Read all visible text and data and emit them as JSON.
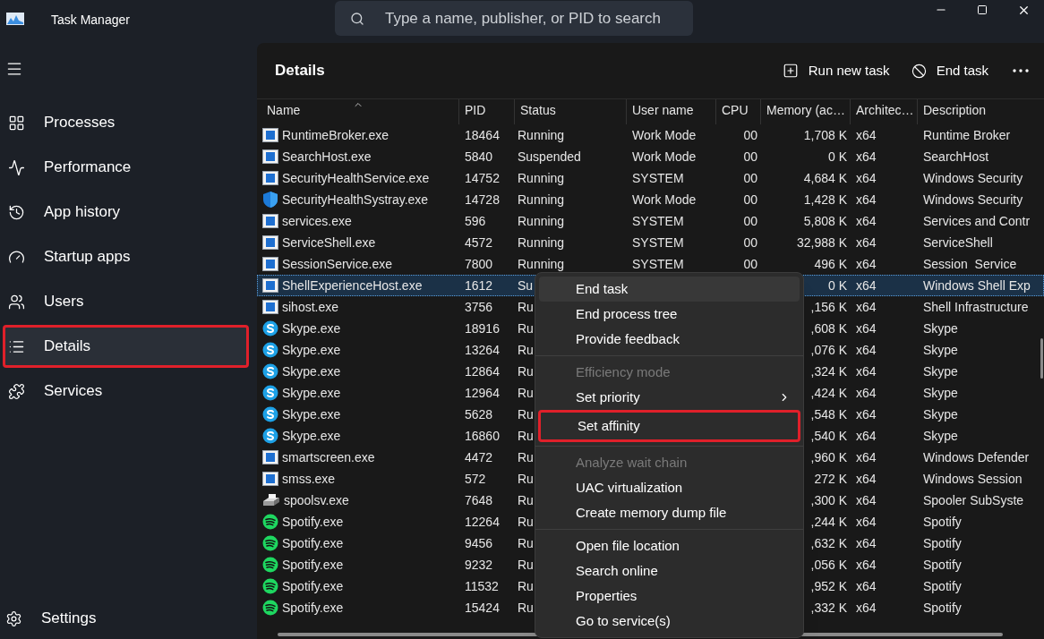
{
  "window": {
    "title": "Task Manager"
  },
  "search": {
    "placeholder": "Type a name, publisher, or PID to search"
  },
  "sidebar": {
    "items": [
      {
        "label": "Processes",
        "selected": false,
        "annotated": false
      },
      {
        "label": "Performance",
        "selected": false,
        "annotated": false
      },
      {
        "label": "App history",
        "selected": false,
        "annotated": false
      },
      {
        "label": "Startup apps",
        "selected": false,
        "annotated": false
      },
      {
        "label": "Users",
        "selected": false,
        "annotated": false
      },
      {
        "label": "Details",
        "selected": true,
        "annotated": true
      },
      {
        "label": "Services",
        "selected": false,
        "annotated": false
      }
    ],
    "footer": {
      "label": "Settings"
    }
  },
  "page": {
    "title": "Details",
    "actions": [
      {
        "label": "Run new task"
      },
      {
        "label": "End task"
      }
    ]
  },
  "table": {
    "columns": [
      {
        "label": "Name",
        "sorted": true
      },
      {
        "label": "PID",
        "sorted": false
      },
      {
        "label": "Status",
        "sorted": false
      },
      {
        "label": "User name",
        "sorted": false
      },
      {
        "label": "CPU",
        "sorted": false
      },
      {
        "label": "Memory (ac…",
        "sorted": false
      },
      {
        "label": "Architec…",
        "sorted": false
      },
      {
        "label": "Description",
        "sorted": false
      }
    ],
    "rows": [
      {
        "kind": "app",
        "selected": false,
        "cells": [
          "RuntimeBroker.exe",
          "18464",
          "Running",
          "Work Mode",
          "00",
          "1,708 K",
          "x64",
          "Runtime Broker"
        ]
      },
      {
        "kind": "app",
        "selected": false,
        "cells": [
          "SearchHost.exe",
          "5840",
          "Suspended",
          "Work Mode",
          "00",
          "0 K",
          "x64",
          "SearchHost"
        ]
      },
      {
        "kind": "app",
        "selected": false,
        "cells": [
          "SecurityHealthService.exe",
          "14752",
          "Running",
          "SYSTEM",
          "00",
          "4,684 K",
          "x64",
          "Windows Security"
        ]
      },
      {
        "kind": "shield",
        "selected": false,
        "cells": [
          "SecurityHealthSystray.exe",
          "14728",
          "Running",
          "Work Mode",
          "00",
          "1,428 K",
          "x64",
          "Windows Security"
        ]
      },
      {
        "kind": "app",
        "selected": false,
        "cells": [
          "services.exe",
          "596",
          "Running",
          "SYSTEM",
          "00",
          "5,808 K",
          "x64",
          "Services and Contr"
        ]
      },
      {
        "kind": "app",
        "selected": false,
        "cells": [
          "ServiceShell.exe",
          "4572",
          "Running",
          "SYSTEM",
          "00",
          "32,988 K",
          "x64",
          "ServiceShell"
        ]
      },
      {
        "kind": "app",
        "selected": false,
        "cells": [
          "SessionService.exe",
          "7800",
          "Running",
          "SYSTEM",
          "00",
          "496 K",
          "x64",
          "Session  Service"
        ]
      },
      {
        "kind": "app",
        "selected": true,
        "cells": [
          "ShellExperienceHost.exe",
          "1612",
          "Su",
          null,
          null,
          "0 K",
          "x64",
          "Windows Shell Exp"
        ]
      },
      {
        "kind": "app",
        "selected": false,
        "cells": [
          "sihost.exe",
          "3756",
          "Ru",
          null,
          null,
          ",156 K",
          "x64",
          "Shell Infrastructure"
        ]
      },
      {
        "kind": "skype",
        "selected": false,
        "cells": [
          "Skype.exe",
          "18916",
          "Ru",
          null,
          null,
          ",608 K",
          "x64",
          "Skype"
        ]
      },
      {
        "kind": "skype",
        "selected": false,
        "cells": [
          "Skype.exe",
          "13264",
          "Ru",
          null,
          null,
          ",076 K",
          "x64",
          "Skype"
        ]
      },
      {
        "kind": "skype",
        "selected": false,
        "cells": [
          "Skype.exe",
          "12864",
          "Ru",
          null,
          null,
          ",324 K",
          "x64",
          "Skype"
        ]
      },
      {
        "kind": "skype",
        "selected": false,
        "cells": [
          "Skype.exe",
          "12964",
          "Ru",
          null,
          null,
          ",424 K",
          "x64",
          "Skype"
        ]
      },
      {
        "kind": "skype",
        "selected": false,
        "cells": [
          "Skype.exe",
          "5628",
          "Ru",
          null,
          null,
          ",548 K",
          "x64",
          "Skype"
        ]
      },
      {
        "kind": "skype",
        "selected": false,
        "cells": [
          "Skype.exe",
          "16860",
          "Ru",
          null,
          null,
          ",540 K",
          "x64",
          "Skype"
        ]
      },
      {
        "kind": "app",
        "selected": false,
        "cells": [
          "smartscreen.exe",
          "4472",
          "Ru",
          null,
          null,
          ",960 K",
          "x64",
          "Windows Defender"
        ]
      },
      {
        "kind": "app",
        "selected": false,
        "cells": [
          "smss.exe",
          "572",
          "Ru",
          null,
          null,
          "272 K",
          "x64",
          "Windows Session"
        ]
      },
      {
        "kind": "printer",
        "selected": false,
        "cells": [
          "spoolsv.exe",
          "7648",
          "Ru",
          null,
          null,
          ",300 K",
          "x64",
          "Spooler SubSyste"
        ]
      },
      {
        "kind": "spotify",
        "selected": false,
        "cells": [
          "Spotify.exe",
          "12264",
          "Ru",
          null,
          null,
          ",244 K",
          "x64",
          "Spotify"
        ]
      },
      {
        "kind": "spotify",
        "selected": false,
        "cells": [
          "Spotify.exe",
          "9456",
          "Ru",
          null,
          null,
          ",632 K",
          "x64",
          "Spotify"
        ]
      },
      {
        "kind": "spotify",
        "selected": false,
        "cells": [
          "Spotify.exe",
          "9232",
          "Ru",
          null,
          null,
          ",056 K",
          "x64",
          "Spotify"
        ]
      },
      {
        "kind": "spotify",
        "selected": false,
        "cells": [
          "Spotify.exe",
          "11532",
          "Ru",
          null,
          null,
          ",952 K",
          "x64",
          "Spotify"
        ]
      },
      {
        "kind": "spotify",
        "selected": false,
        "cells": [
          "Spotify.exe",
          "15424",
          "Ru",
          null,
          null,
          ",332 K",
          "x64",
          "Spotify"
        ]
      }
    ]
  },
  "context_menu": {
    "items": [
      {
        "kind": "item",
        "label": "End task",
        "disabled": false,
        "hovered": true,
        "submenu": false,
        "annotated": false
      },
      {
        "kind": "item",
        "label": "End process tree",
        "disabled": false,
        "hovered": false,
        "submenu": false,
        "annotated": false
      },
      {
        "kind": "item",
        "label": "Provide feedback",
        "disabled": false,
        "hovered": false,
        "submenu": false,
        "annotated": false
      },
      {
        "kind": "separator"
      },
      {
        "kind": "item",
        "label": "Efficiency mode",
        "disabled": true,
        "hovered": false,
        "submenu": false,
        "annotated": false
      },
      {
        "kind": "item",
        "label": "Set priority",
        "disabled": false,
        "hovered": false,
        "submenu": true,
        "annotated": false
      },
      {
        "kind": "item",
        "label": "Set affinity",
        "disabled": false,
        "hovered": false,
        "submenu": false,
        "annotated": true
      },
      {
        "kind": "separator"
      },
      {
        "kind": "item",
        "label": "Analyze wait chain",
        "disabled": true,
        "hovered": false,
        "submenu": false,
        "annotated": false
      },
      {
        "kind": "item",
        "label": "UAC virtualization",
        "disabled": false,
        "hovered": false,
        "submenu": false,
        "annotated": false
      },
      {
        "kind": "item",
        "label": "Create memory dump file",
        "disabled": false,
        "hovered": false,
        "submenu": false,
        "annotated": false
      },
      {
        "kind": "separator"
      },
      {
        "kind": "item",
        "label": "Open file location",
        "disabled": false,
        "hovered": false,
        "submenu": false,
        "annotated": false
      },
      {
        "kind": "item",
        "label": "Search online",
        "disabled": false,
        "hovered": false,
        "submenu": false,
        "annotated": false
      },
      {
        "kind": "item",
        "label": "Properties",
        "disabled": false,
        "hovered": false,
        "submenu": false,
        "annotated": false
      },
      {
        "kind": "item",
        "label": "Go to service(s)",
        "disabled": false,
        "hovered": false,
        "submenu": false,
        "annotated": false
      }
    ]
  }
}
